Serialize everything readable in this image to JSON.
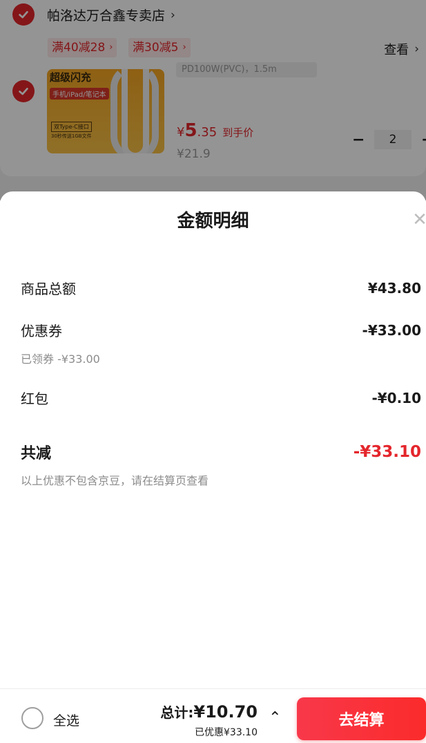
{
  "cart": {
    "shop_name": "帕洛达万合鑫专卖店",
    "promos": [
      "满40减28",
      "满30减5"
    ],
    "view_label": "查看",
    "product": {
      "image_text": "超级闪充",
      "image_sub": "手机/iPad/笔记本",
      "image_tag": "双Type-C接口",
      "image_tag2": "30秒传送1GB文件",
      "spec": "PD100W(PVC)，1.5m",
      "price_currency": "¥",
      "price_int": "5",
      "price_dec": ".35",
      "price_label": "到手价",
      "old_price": "¥21.9",
      "quantity": "2"
    }
  },
  "sheet": {
    "title": "金额明细",
    "rows": [
      {
        "label": "商品总额",
        "value": "¥43.80"
      },
      {
        "label": "优惠券",
        "value": "-¥33.00",
        "sub": "已领券 -¥33.00"
      },
      {
        "label": "红包",
        "value": "-¥0.10"
      }
    ],
    "sum": {
      "label": "共减",
      "value": "-¥33.10"
    },
    "note": "以上优惠不包含京豆，请在结算页查看"
  },
  "bottom_bar": {
    "select_all": "全选",
    "total_label": "总计:",
    "total_value": "¥10.70",
    "saved": "已优惠¥33.10",
    "checkout": "去结算"
  },
  "colors": {
    "accent": "#e4262c",
    "promo_bg": "#fde8e8",
    "muted_text": "#8c8c8c"
  },
  "icons": [
    "check-icon",
    "chevron-right-icon",
    "close-icon",
    "chevron-up-icon",
    "minus-icon",
    "plus-icon"
  ]
}
